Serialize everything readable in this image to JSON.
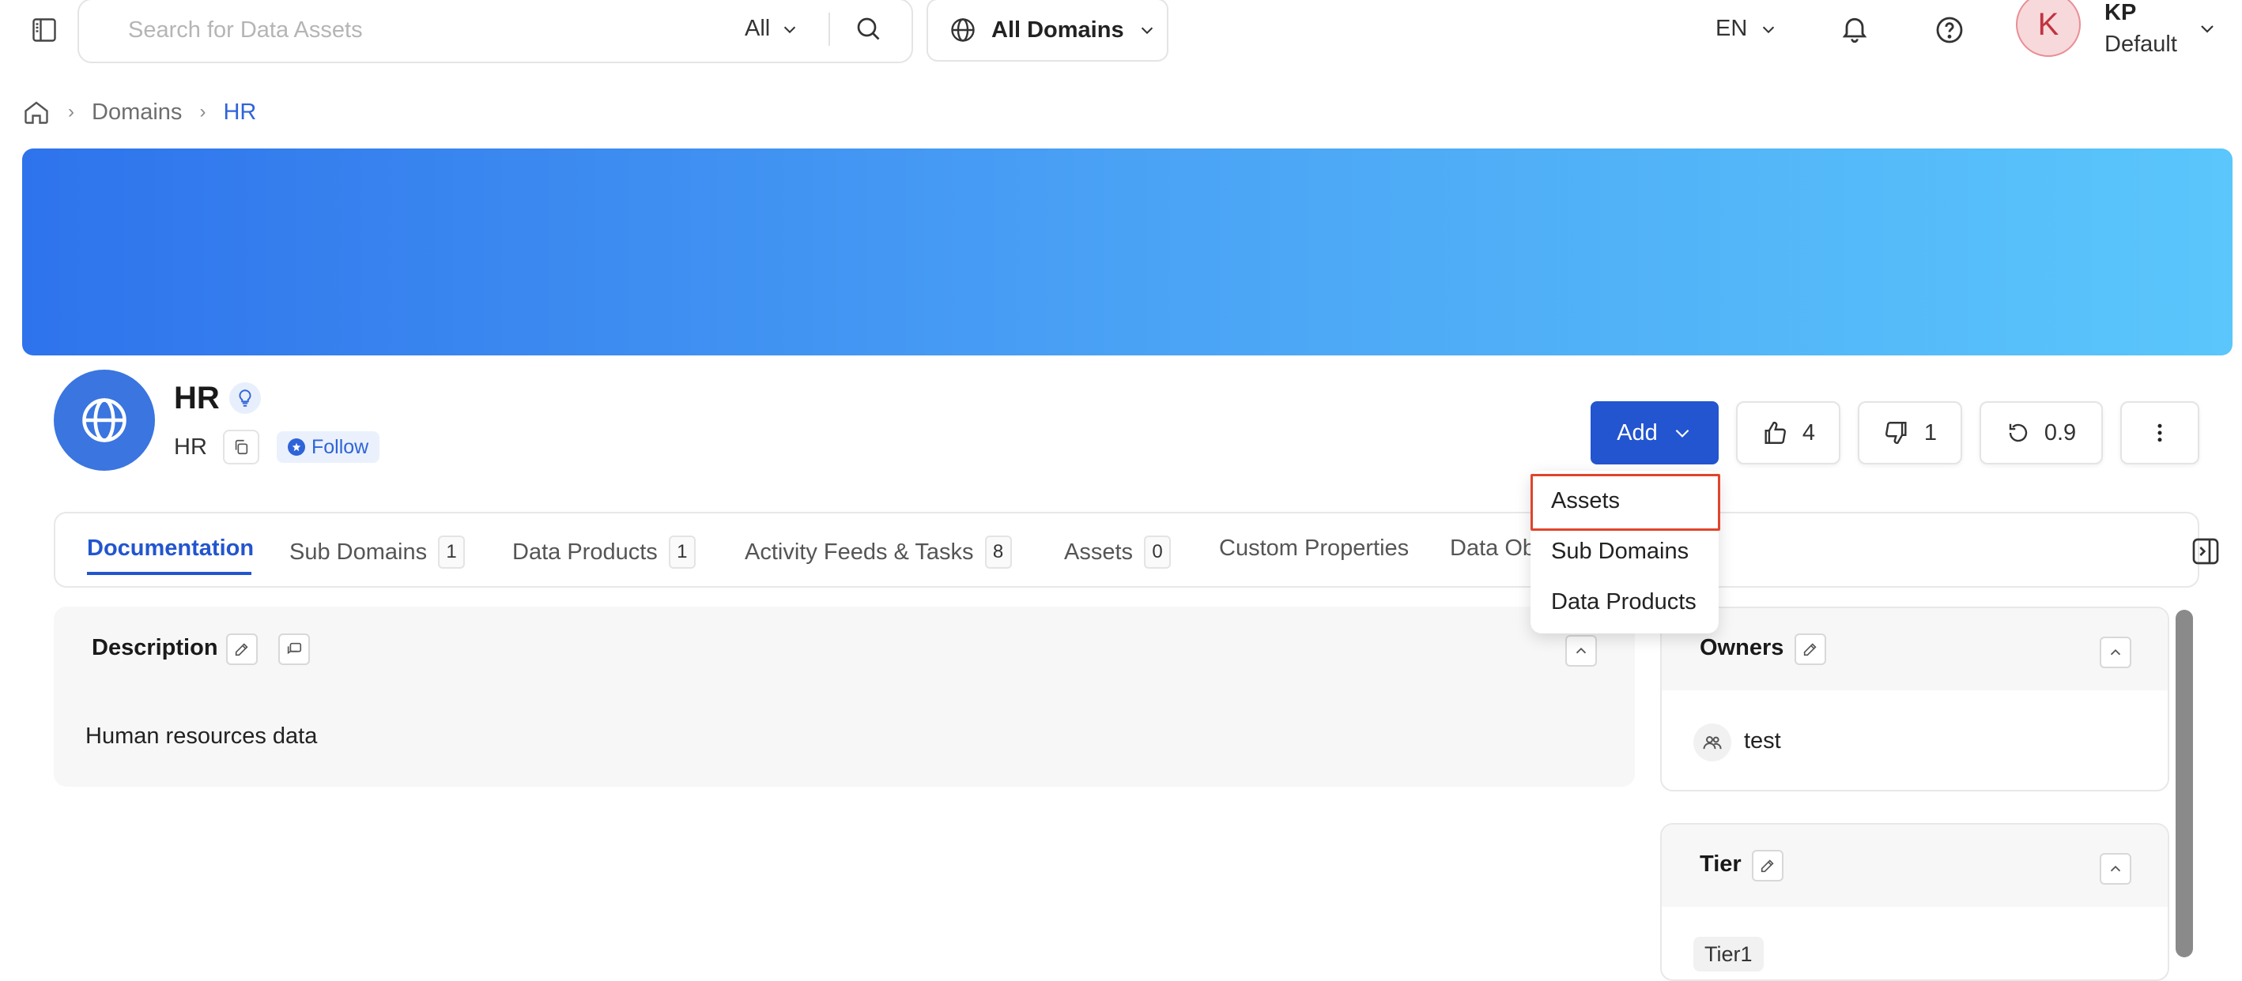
{
  "search": {
    "placeholder": "Search for Data Assets",
    "filter": "All"
  },
  "domain_selector": {
    "label": "All Domains"
  },
  "header": {
    "language": "EN"
  },
  "user": {
    "initial": "K",
    "name": "KP",
    "role": "Default"
  },
  "breadcrumb": {
    "items": [
      "Domains",
      "HR"
    ]
  },
  "entity": {
    "title": "HR",
    "subtitle": "HR",
    "follow_label": "Follow"
  },
  "actions": {
    "add_label": "Add",
    "upvotes": "4",
    "downvotes": "1",
    "version": "0.9"
  },
  "add_menu": {
    "items": [
      "Assets",
      "Sub Domains",
      "Data Products"
    ]
  },
  "tabs": [
    {
      "label": "Documentation",
      "count": ""
    },
    {
      "label": "Sub Domains",
      "count": "1"
    },
    {
      "label": "Data Products",
      "count": "1"
    },
    {
      "label": "Activity Feeds & Tasks",
      "count": "8"
    },
    {
      "label": "Assets",
      "count": "0"
    },
    {
      "label": "Custom Properties",
      "count": ""
    },
    {
      "label": "Data Ob",
      "count": ""
    }
  ],
  "description": {
    "title": "Description",
    "text": "Human resources data"
  },
  "owners": {
    "title": "Owners",
    "items": [
      "test"
    ]
  },
  "tier": {
    "title": "Tier",
    "value": "Tier1"
  },
  "colors": {
    "primary": "#2255cf",
    "banner_start": "#2e73ec",
    "banner_end": "#5ac6fb",
    "highlight": "#e0442c"
  }
}
